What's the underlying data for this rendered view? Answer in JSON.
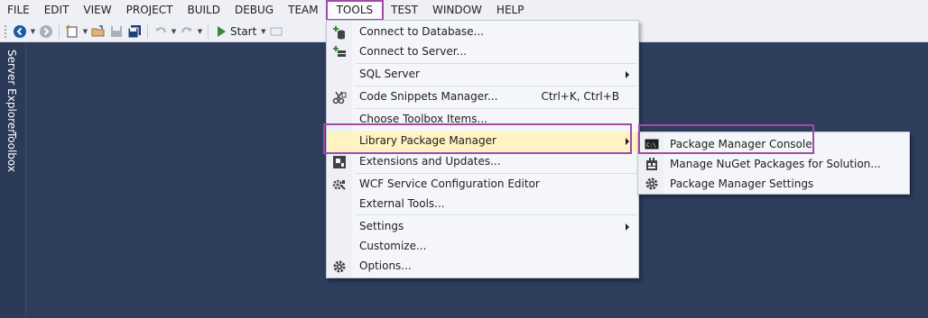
{
  "menubar": {
    "items": [
      "FILE",
      "EDIT",
      "VIEW",
      "PROJECT",
      "BUILD",
      "DEBUG",
      "TEAM",
      "TOOLS",
      "TEST",
      "WINDOW",
      "HELP"
    ],
    "active": "TOOLS"
  },
  "toolbar": {
    "start_label": "Start"
  },
  "siderail": {
    "tabs": [
      "Server Explorer",
      "Toolbox"
    ]
  },
  "tools_menu": {
    "items": [
      {
        "label": "Connect to Database...",
        "icon": "add-database-icon"
      },
      {
        "label": "Connect to Server...",
        "icon": "add-server-icon"
      },
      {
        "label": "SQL Server",
        "submenu": true
      },
      {
        "label": "Code Snippets Manager...",
        "shortcut": "Ctrl+K, Ctrl+B",
        "icon": "code-snippets-icon"
      },
      {
        "label": "Choose Toolbox Items..."
      },
      {
        "label": "Library Package Manager",
        "submenu": true,
        "highlighted": true
      },
      {
        "label": "Extensions and Updates...",
        "icon": "extensions-icon"
      },
      {
        "label": "WCF Service Configuration Editor",
        "icon": "wcf-config-icon"
      },
      {
        "label": "External Tools..."
      },
      {
        "label": "Settings",
        "submenu": true
      },
      {
        "label": "Customize..."
      },
      {
        "label": "Options...",
        "icon": "options-gear-icon"
      }
    ]
  },
  "package_submenu": {
    "items": [
      {
        "label": "Package Manager Console",
        "icon": "console-icon"
      },
      {
        "label": "Manage NuGet Packages for Solution...",
        "icon": "nuget-package-icon"
      },
      {
        "label": "Package Manager Settings",
        "icon": "settings-gear-icon"
      }
    ]
  },
  "colors": {
    "menubar_bg": "#eef0f5",
    "workspace_bg": "#2e3d5c",
    "highlight_bg": "#fff3c2",
    "annotation_outline": "#a24aa8"
  }
}
